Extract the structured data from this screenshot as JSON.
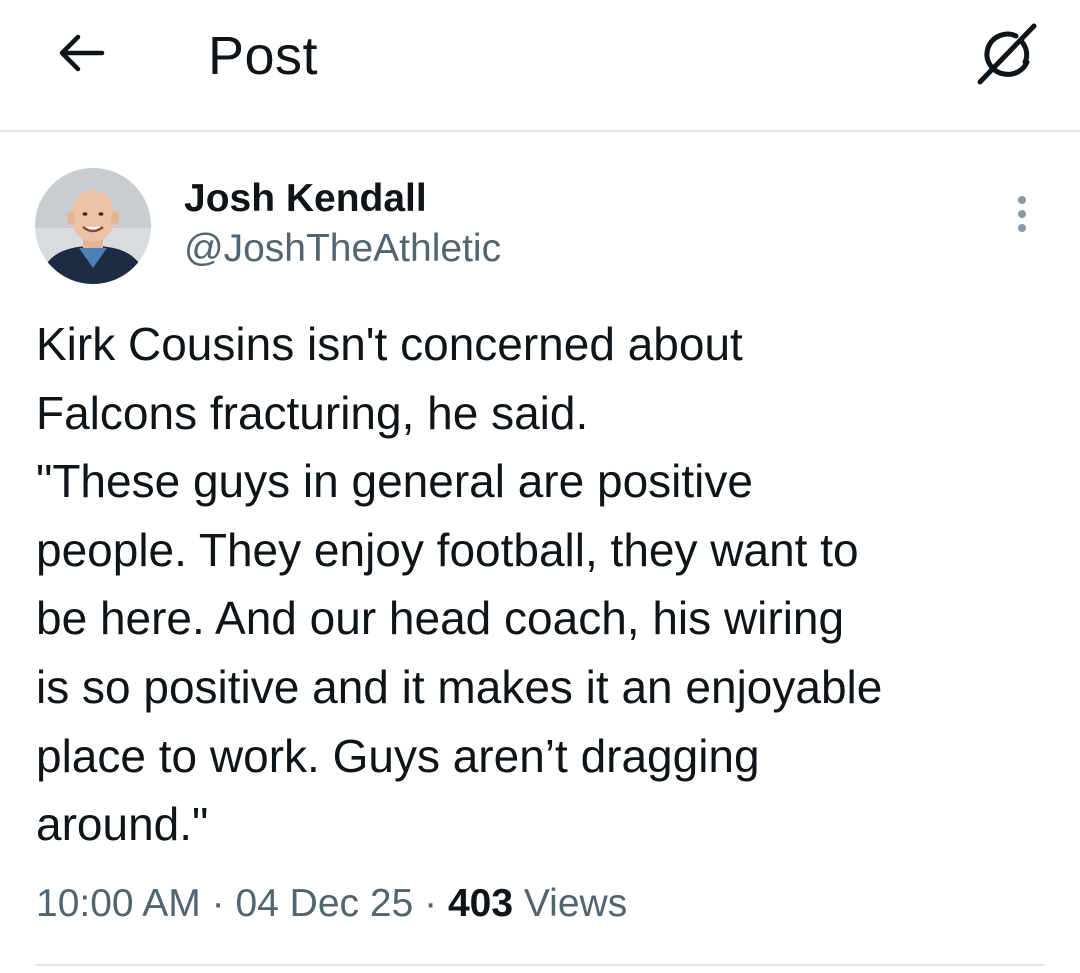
{
  "header": {
    "title": "Post",
    "back_icon": "arrow-left-icon",
    "grok_icon": "grok-icon"
  },
  "post": {
    "author": {
      "name": "Josh Kendall",
      "handle": "@JoshTheAthletic",
      "avatar_icon": "profile-photo"
    },
    "more_icon": "more-vertical-icon",
    "text": "Kirk Cousins isn't concerned about\nFalcons fracturing, he said.\n\"These guys in general are positive\npeople. They enjoy football, they want to\nbe here. And our head coach, his wiring\nis so positive and it makes it an enjoyable\nplace to work. Guys aren’t dragging\naround.\"",
    "time": "10:00 AM",
    "separator": "·",
    "date": "04 Dec 25",
    "views_count": "403",
    "views_label": "Views"
  },
  "colors": {
    "text": "#0f1419",
    "secondary_text": "#536471",
    "divider": "#e1e4e8",
    "background": "#ffffff"
  }
}
